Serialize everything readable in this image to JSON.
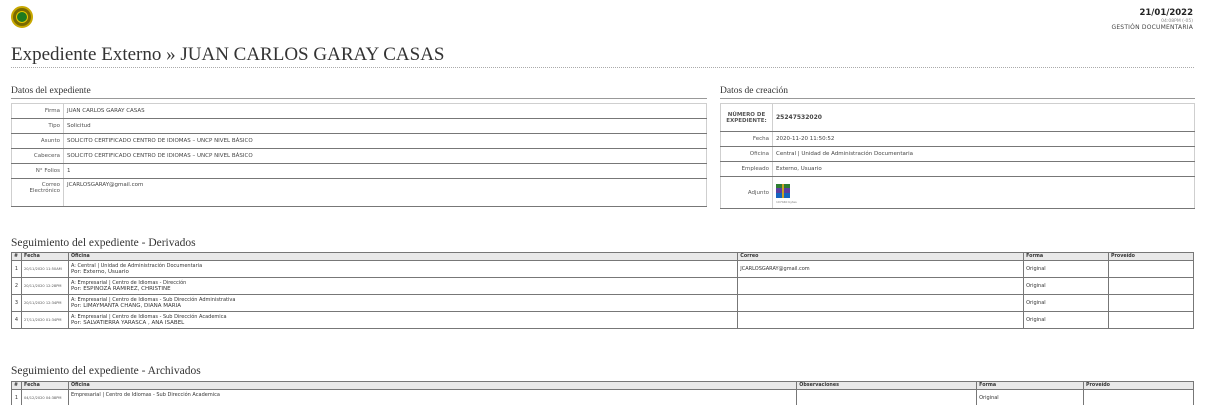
{
  "header": {
    "date": "21/01/2022",
    "time": "04:08PM (-05)",
    "area": "GESTIÓN DOCUMENTARIA",
    "title": "Expediente Externo » JUAN CARLOS GARAY CASAS"
  },
  "expediente": {
    "heading": "Datos del expediente",
    "rows": [
      {
        "label": "Firma",
        "value": "JUAN CARLOS GARAY CASAS"
      },
      {
        "label": "Tipo",
        "value": "Solicitud"
      },
      {
        "label": "Asunto",
        "value": "SOLICITO CERTIFICADO CENTRO DE IDIOMAS – UNCP NIVEL BÁSICO"
      },
      {
        "label": "Cabecera",
        "value": "SOLICITO CERTIFICADO CENTRO DE IDIOMAS – UNCP NIVEL BÁSICO"
      },
      {
        "label": "N° Folios",
        "value": "1"
      },
      {
        "label": "Correo Electrónico",
        "value": "JCARLOSGARAY@gmail.com"
      }
    ]
  },
  "creacion": {
    "heading": "Datos de creación",
    "numero_label": "NÚMERO DE EXPEDIENTE:",
    "numero_value": "25247532020",
    "rows": [
      {
        "label": "Fecha",
        "value": "2020-11-20 11:50:52"
      },
      {
        "label": "Oficina",
        "value": "Central | Unidad de Administración Documentaria"
      },
      {
        "label": "Empleado",
        "value": "Externo, Usuario"
      }
    ],
    "adjunto_label": "Adjunto",
    "adjunto_size": "107440 bytes",
    "adjunto_icon": "winrar-archive-icon"
  },
  "derivados": {
    "heading": "Seguimiento del expediente - Derivados",
    "columns": [
      "#",
      "Fecha",
      "Oficina",
      "Correo",
      "Forma",
      "Proveído"
    ],
    "rows": [
      {
        "n": "1",
        "fecha": "20/11/2020 11:50AM",
        "oficina": "A: Central | Unidad de Administración Documentaria",
        "por": "Por: Externo, Usuario",
        "correo": "JCARLOSGARAY@gmail.com",
        "forma": "Original",
        "proveido": ""
      },
      {
        "n": "2",
        "fecha": "20/11/2020 12:28PM",
        "oficina": "A: Empresarial | Centro de Idiomas - Dirección",
        "por": "Por: ESPINOZA RAMIREZ, CHRISTINE",
        "correo": "",
        "forma": "Original",
        "proveido": ""
      },
      {
        "n": "3",
        "fecha": "20/11/2020 12:34PM",
        "oficina": "A: Empresarial | Centro de Idiomas - Sub Dirección Administrativa",
        "por": "Por: LIMAYMANTA CHANG, DIANA MARIA",
        "correo": "",
        "forma": "Original",
        "proveido": ""
      },
      {
        "n": "4",
        "fecha": "27/11/2020 01:34PM",
        "oficina": "A: Empresarial | Centro de Idiomas - Sub Dirección Academica",
        "por": "Por: SALVATIERRA YARASCA , ANA ISABEL",
        "correo": "",
        "forma": "Original",
        "proveido": ""
      }
    ]
  },
  "archivados": {
    "heading": "Seguimiento del expediente - Archivados",
    "columns": [
      "#",
      "Fecha",
      "Oficina",
      "Observaciones",
      "Forma",
      "Proveído"
    ],
    "rows": [
      {
        "n": "1",
        "fecha": "04/12/2020 04:38PM",
        "oficina": "Empresarial | Centro de Idiomas - Sub Dirección Academica",
        "observaciones": "",
        "forma": "Original",
        "proveido": ""
      }
    ]
  }
}
